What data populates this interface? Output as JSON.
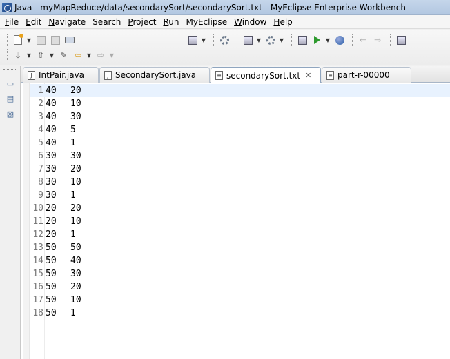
{
  "window": {
    "title": "Java - myMapReduce/data/secondarySort/secondarySort.txt - MyEclipse Enterprise Workbench"
  },
  "menu": [
    {
      "mn": "F",
      "rest": "ile"
    },
    {
      "mn": "E",
      "rest": "dit"
    },
    {
      "mn": "N",
      "rest": "avigate"
    },
    {
      "mn": "",
      "rest": "Search"
    },
    {
      "mn": "P",
      "rest": "roject"
    },
    {
      "mn": "R",
      "rest": "un"
    },
    {
      "mn": "",
      "rest": "MyEclipse"
    },
    {
      "mn": "W",
      "rest": "indow"
    },
    {
      "mn": "H",
      "rest": "elp"
    }
  ],
  "tabs": [
    {
      "label": "IntPair.java",
      "icon": "java-file-icon"
    },
    {
      "label": "SecondarySort.java",
      "icon": "java-file-icon"
    },
    {
      "label": "secondarySort.txt",
      "icon": "text-file-icon",
      "active": true
    },
    {
      "label": "part-r-00000",
      "icon": "text-file-icon"
    }
  ],
  "editor": {
    "lines": [
      {
        "num": "1",
        "a": "40",
        "b": "20"
      },
      {
        "num": "2",
        "a": "40",
        "b": "10"
      },
      {
        "num": "3",
        "a": "40",
        "b": "30"
      },
      {
        "num": "4",
        "a": "40",
        "b": "5"
      },
      {
        "num": "5",
        "a": "40",
        "b": "1"
      },
      {
        "num": "6",
        "a": "30",
        "b": "30"
      },
      {
        "num": "7",
        "a": "30",
        "b": "20"
      },
      {
        "num": "8",
        "a": "30",
        "b": "10"
      },
      {
        "num": "9",
        "a": "30",
        "b": "1"
      },
      {
        "num": "10",
        "a": "20",
        "b": "20"
      },
      {
        "num": "11",
        "a": "20",
        "b": "10"
      },
      {
        "num": "12",
        "a": "20",
        "b": "1"
      },
      {
        "num": "13",
        "a": "50",
        "b": "50"
      },
      {
        "num": "14",
        "a": "50",
        "b": "40"
      },
      {
        "num": "15",
        "a": "50",
        "b": "30"
      },
      {
        "num": "16",
        "a": "50",
        "b": "20"
      },
      {
        "num": "17",
        "a": "50",
        "b": "10"
      },
      {
        "num": "18",
        "a": "50",
        "b": "1"
      }
    ]
  },
  "colors": {
    "current_line": "#e8f2fe",
    "line_number": "#787878"
  }
}
